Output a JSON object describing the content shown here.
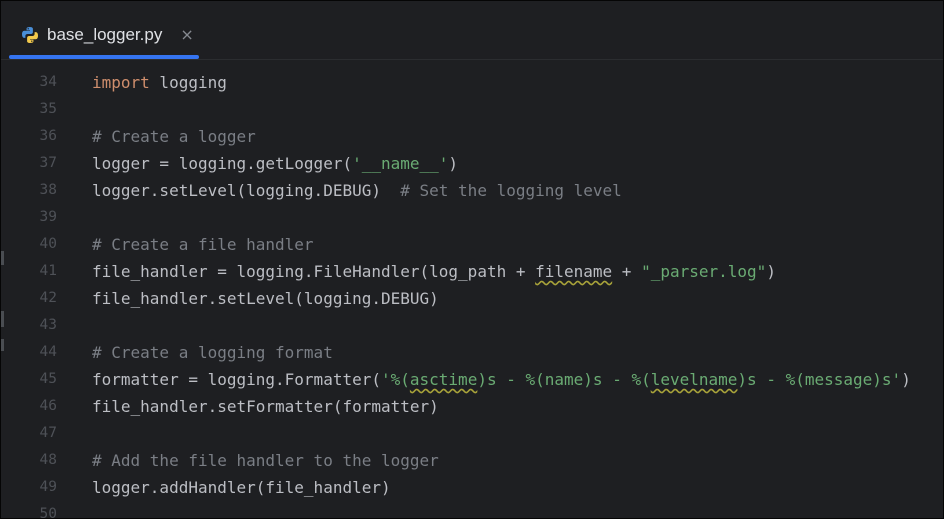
{
  "tab": {
    "filename": "base_logger.py",
    "close_glyph": "×",
    "icon": "python-icon",
    "accent_color": "#3574f0"
  },
  "editor": {
    "colors": {
      "keyword": "#cf8e6d",
      "comment": "#7a7e85",
      "string": "#6aab73",
      "text": "#bcbec4",
      "line_number": "#4e5157",
      "background": "#1e1f22"
    },
    "lines": [
      {
        "num": "34",
        "tokens": [
          {
            "t": "import",
            "c": "kw"
          },
          {
            "t": " logging"
          }
        ]
      },
      {
        "num": "35",
        "tokens": []
      },
      {
        "num": "36",
        "tokens": [
          {
            "t": "# Create a logger",
            "c": "cm"
          }
        ]
      },
      {
        "num": "37",
        "tokens": [
          {
            "t": "logger = logging.getLogger("
          },
          {
            "t": "'__name__'",
            "c": "st"
          },
          {
            "t": ")"
          }
        ]
      },
      {
        "num": "38",
        "tokens": [
          {
            "t": "logger.setLevel(logging.DEBUG)  "
          },
          {
            "t": "# Set the logging level",
            "c": "cm"
          }
        ]
      },
      {
        "num": "39",
        "tokens": []
      },
      {
        "num": "40",
        "tokens": [
          {
            "t": "# Create a file handler",
            "c": "cm"
          }
        ]
      },
      {
        "num": "41",
        "tokens": [
          {
            "t": "file_handler = logging.FileHandler(log_path + "
          },
          {
            "t": "filename",
            "c": "ty"
          },
          {
            "t": " + "
          },
          {
            "t": "\"_parser.log\"",
            "c": "st"
          },
          {
            "t": ")"
          }
        ]
      },
      {
        "num": "42",
        "tokens": [
          {
            "t": "file_handler.setLevel(logging.DEBUG)"
          }
        ]
      },
      {
        "num": "43",
        "tokens": []
      },
      {
        "num": "44",
        "tokens": [
          {
            "t": "# Create a logging format",
            "c": "cm"
          }
        ]
      },
      {
        "num": "45",
        "tokens": [
          {
            "t": "formatter = logging.Formatter("
          },
          {
            "t": "'%(",
            "c": "st"
          },
          {
            "t": "asctime",
            "c": "st ty"
          },
          {
            "t": ")s - %(name)s - %(",
            "c": "st"
          },
          {
            "t": "levelname",
            "c": "st ty"
          },
          {
            "t": ")s - %(message)s'",
            "c": "st"
          },
          {
            "t": ")"
          }
        ]
      },
      {
        "num": "46",
        "tokens": [
          {
            "t": "file_handler.setFormatter(formatter)"
          }
        ]
      },
      {
        "num": "47",
        "tokens": []
      },
      {
        "num": "48",
        "tokens": [
          {
            "t": "# Add the file handler to the logger",
            "c": "cm"
          }
        ]
      },
      {
        "num": "49",
        "tokens": [
          {
            "t": "logger.addHandler(file_handler)"
          }
        ]
      },
      {
        "num": "50",
        "tokens": []
      }
    ]
  }
}
